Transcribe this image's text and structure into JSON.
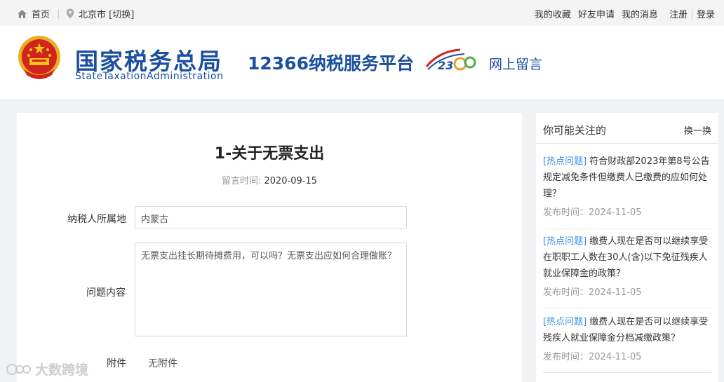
{
  "topbar": {
    "home": "首页",
    "city": "北京市 [切换]",
    "links": [
      "我的收藏",
      "好友申请",
      "我的消息"
    ],
    "register": "注册",
    "login": "登录"
  },
  "header": {
    "brand_cn": "国家税务总局",
    "brand_en": "StateTaxationAdministration",
    "platform": "12366纳税服务平台",
    "section": "网上留言"
  },
  "question": {
    "title": "1-关于无票支出",
    "time_label": "留言时间:",
    "time_value": "2020-09-15",
    "region_label": "纳税人所属地",
    "region_value": "内蒙古",
    "content_label": "问题内容",
    "content_value": "无票支出挂长期待摊费用，可以吗？无票支出应如何合理做账？",
    "attach_label": "附件",
    "attach_value": "无附件"
  },
  "sidebar": {
    "title": "你可能关注的",
    "refresh": "换一换",
    "items": [
      {
        "tag": "[热点问题]",
        "text": " 符合财政部2023年第8号公告规定减免条件但缴费人已缴费的应如何处理？",
        "date": "发布时间：2024-11-05"
      },
      {
        "tag": "[热点问题]",
        "text": " 缴费人现在是否可以继续享受在职职工人数在30人(含)以下免征残疾人就业保障金的政策？",
        "date": "发布时间：2024-11-05"
      },
      {
        "tag": "[热点问题]",
        "text": " 缴费人现在是否可以继续享受残疾人就业保障金分档减缴政策？",
        "date": "发布时间：2024-11-05"
      }
    ]
  },
  "watermark": "大数跨境",
  "colors": {
    "brand": "#1b4fa0",
    "tag": "#3a8ee6",
    "background": "#f1f2f4"
  }
}
